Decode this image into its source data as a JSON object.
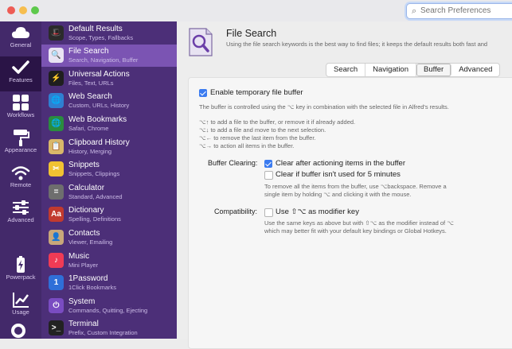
{
  "window": {
    "search_placeholder": "Search Preferences",
    "traffic_lights": [
      "#ee5c55",
      "#f6be4f",
      "#5ec94c"
    ]
  },
  "rail": [
    {
      "label": "General",
      "icon": "cloud-icon"
    },
    {
      "label": "Features",
      "icon": "checkmark-icon",
      "active": true
    },
    {
      "label": "Workflows",
      "icon": "grid-icon"
    },
    {
      "label": "Appearance",
      "icon": "paint-roller-icon"
    },
    {
      "label": "Remote",
      "icon": "wifi-icon"
    },
    {
      "label": "Advanced",
      "icon": "sliders-icon"
    },
    {
      "label": "Powerpack",
      "icon": "battery-icon"
    },
    {
      "label": "Usage",
      "icon": "chart-icon"
    }
  ],
  "features": [
    {
      "title": "Default Results",
      "subtitle": "Scope, Types, Fallbacks",
      "icon": "magic-hat-icon",
      "color": "#2b2b2b",
      "glyph": "🎩"
    },
    {
      "title": "File Search",
      "subtitle": "Search, Navigation, Buffer",
      "icon": "file-search-icon",
      "color": "#e9e3f3",
      "glyph": "🔍",
      "active": true
    },
    {
      "title": "Universal Actions",
      "subtitle": "Files, Text, URLs",
      "icon": "universal-actions-icon",
      "color": "#1f1f1f",
      "glyph": "⚡"
    },
    {
      "title": "Web Search",
      "subtitle": "Custom, URLs, History",
      "icon": "web-search-icon",
      "color": "#2f7fd1",
      "glyph": "🌐"
    },
    {
      "title": "Web Bookmarks",
      "subtitle": "Safari, Chrome",
      "icon": "web-bookmarks-icon",
      "color": "#2a8c3f",
      "glyph": "🌐"
    },
    {
      "title": "Clipboard History",
      "subtitle": "History, Merging",
      "icon": "clipboard-icon",
      "color": "#d8b76a",
      "glyph": "📋"
    },
    {
      "title": "Snippets",
      "subtitle": "Snippets, Clippings",
      "icon": "snippets-icon",
      "color": "#f1c232",
      "glyph": "✂"
    },
    {
      "title": "Calculator",
      "subtitle": "Standard, Advanced",
      "icon": "calculator-icon",
      "color": "#6e6e6e",
      "glyph": "="
    },
    {
      "title": "Dictionary",
      "subtitle": "Spelling, Definitions",
      "icon": "dictionary-icon",
      "color": "#c23a2f",
      "glyph": "Aa"
    },
    {
      "title": "Contacts",
      "subtitle": "Viewer, Emailing",
      "icon": "contacts-icon",
      "color": "#c8a77a",
      "glyph": "👤"
    },
    {
      "title": "Music",
      "subtitle": "Mini Player",
      "icon": "music-icon",
      "color": "#f03b55",
      "glyph": "♪"
    },
    {
      "title": "1Password",
      "subtitle": "1Click Bookmarks",
      "icon": "onepassword-icon",
      "color": "#2f6fd8",
      "glyph": "1"
    },
    {
      "title": "System",
      "subtitle": "Commands, Quitting, Ejecting",
      "icon": "power-icon",
      "color": "#7a4cc2",
      "glyph": "⏻"
    },
    {
      "title": "Terminal",
      "subtitle": "Prefix, Custom Integration",
      "icon": "terminal-icon",
      "color": "#222222",
      "glyph": ">_"
    }
  ],
  "header": {
    "title": "File Search",
    "description": "Using the file search keywords is the best way to find files; it keeps the default results both fast and"
  },
  "tabs": [
    "Search",
    "Navigation",
    "Buffer",
    "Advanced"
  ],
  "active_tab": "Buffer",
  "buffer": {
    "enable_label": "Enable temporary file buffer",
    "enable_checked": true,
    "intro": "The buffer is controlled using the ⌥ key in combination with the selected file in Alfred's results.",
    "shortcuts": [
      "⌥↑ to add a file to the buffer, or remove it if already added.",
      "⌥↓ to add a file and move to the next selection.",
      "⌥← to remove the last item from the buffer.",
      "⌥→ to action all items in the buffer."
    ],
    "clearing_label": "Buffer Clearing:",
    "clear_after_label": "Clear after actioning items in the buffer",
    "clear_after_checked": true,
    "clear_unused_label": "Clear if buffer isn't used for 5 minutes",
    "clear_unused_checked": false,
    "remove_note_1": "To remove all the items from the buffer, use ⌥backspace. Remove a",
    "remove_note_2": "single item by holding ⌥ and clicking it with the mouse.",
    "compat_label": "Compatibility:",
    "modifier_label": "Use ⇧⌥ as modifier key",
    "modifier_checked": false,
    "compat_note_1": "Use the same keys as above but with ⇧⌥ as the modifier instead of ⌥",
    "compat_note_2": "which may better fit with your default key bindings or Global Hotkeys."
  }
}
